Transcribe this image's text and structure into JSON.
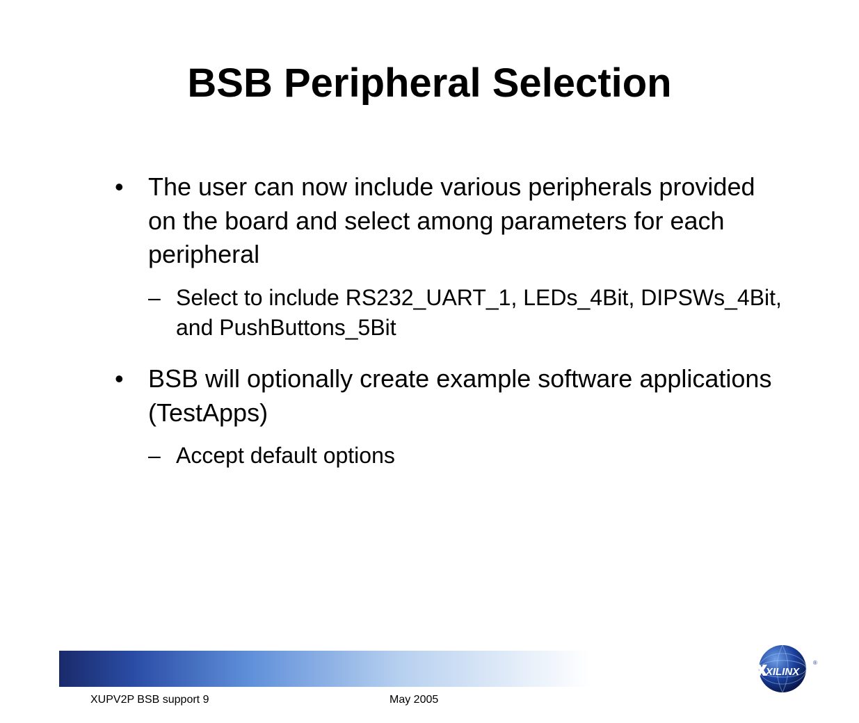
{
  "title": "BSB Peripheral Selection",
  "bullets": {
    "b1": "The user can now include various peripherals provided on the board and select among parameters for each peripheral",
    "b1_sub1": "Select to include RS232_UART_1, LEDs_4Bit, DIPSWs_4Bit, and PushButtons_5Bit",
    "b2": "BSB will optionally create example software applications (TestApps)",
    "b2_sub1": "Accept default options"
  },
  "footer": {
    "left": "XUPV2P BSB support   9",
    "center": "May 2005",
    "logo_text": "XILINX"
  }
}
